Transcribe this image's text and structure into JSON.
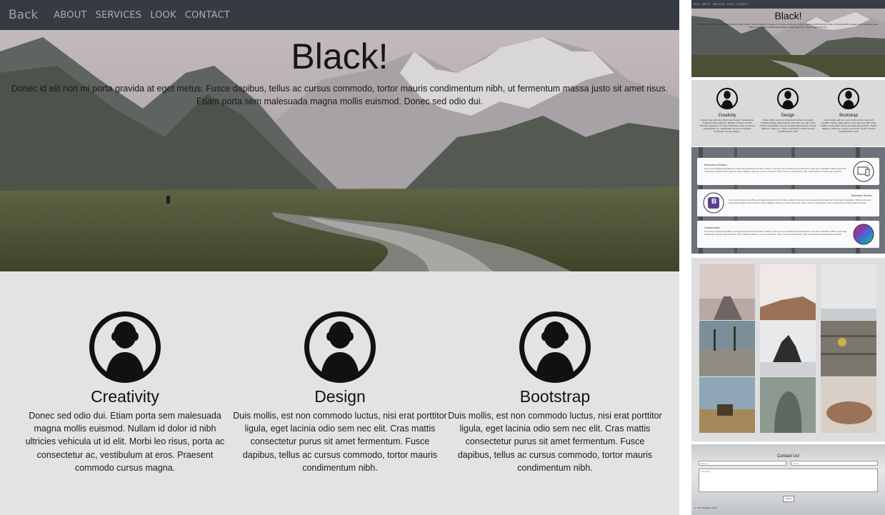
{
  "nav": {
    "brand": "Back",
    "links": [
      "ABOUT",
      "SERVICES",
      "LOOK",
      "CONTACT"
    ]
  },
  "hero": {
    "title": "Black!",
    "text": "Donec id elit non mi porta gravida at eget metus. Fusce dapibus, tellus ac cursus commodo, tortor mauris condimentum nibh, ut fermentum massa justo sit amet risus. Etiam porta sem malesuada magna mollis euismod. Donec sed odio dui."
  },
  "features": [
    {
      "title": "Creativity",
      "text": "Donec sed odio dui. Etiam porta sem malesuada magna mollis euismod. Nullam id dolor id nibh ultricies vehicula ut id elit. Morbi leo risus, porta ac consectetur ac, vestibulum at eros. Praesent commodo cursus magna."
    },
    {
      "title": "Design",
      "text": "Duis mollis, est non commodo luctus, nisi erat porttitor ligula, eget lacinia odio sem nec elit. Cras mattis consectetur purus sit amet fermentum. Fusce dapibus, tellus ac cursus commodo, tortor mauris condimentum nibh."
    },
    {
      "title": "Bootstrap",
      "text": "Duis mollis, est non commodo luctus, nisi erat porttitor ligula, eget lacinia odio sem nec elit. Cras mattis consectetur purus sit amet fermentum. Fusce dapibus, tellus ac cursus commodo, tortor mauris condimentum nibh."
    }
  ],
  "preview": {
    "panels": [
      {
        "title": "Responsive Designs",
        "text": "Cum sociis natoque penatibus et magnis dis parturient montes, nascetur ridiculus mus. Aenean lacinia bibendum nulla sed consectetur. Etiam porta sem malesuada magna mollis euismod. Fusce dapibus, tellus ac cursus commodo, tortor mauris condimentum nibh, ut fermentum massa justo sit amet."
      },
      {
        "title": "Bootstrap Themes",
        "text": "Cum sociis natoque penatibus et magnis dis parturient montes, nascetur ridiculus mus. Aenean lacinia bibendum nulla sed consectetur. Etiam porta sem malesuada magna mollis euismod. Fusce dapibus, tellus ac cursus commodo, tortor mauris condimentum nibh, ut fermentum massa justo sit amet."
      },
      {
        "title": "Customizable",
        "text": "Cum sociis natoque penatibus et magnis dis parturient montes, nascetur ridiculus mus. Aenean lacinia bibendum nulla sed consectetur. Etiam porta sem malesuada magna mollis euismod. Fusce dapibus, tellus ac cursus commodo, tortor mauris condimentum nibh, ut fermentum massa justo sit amet."
      }
    ],
    "bootstrap_logo": "B",
    "contact": {
      "title": "Contact Us!",
      "name_placeholder": "Name",
      "email_placeholder": "Email",
      "message_placeholder": "Message",
      "send_label": "Send"
    },
    "footer": "© T&T Designs 2019"
  },
  "colors": {
    "navbar": "#363a41",
    "features_bg": "#e3e3e3",
    "text_dark": "#111111"
  }
}
